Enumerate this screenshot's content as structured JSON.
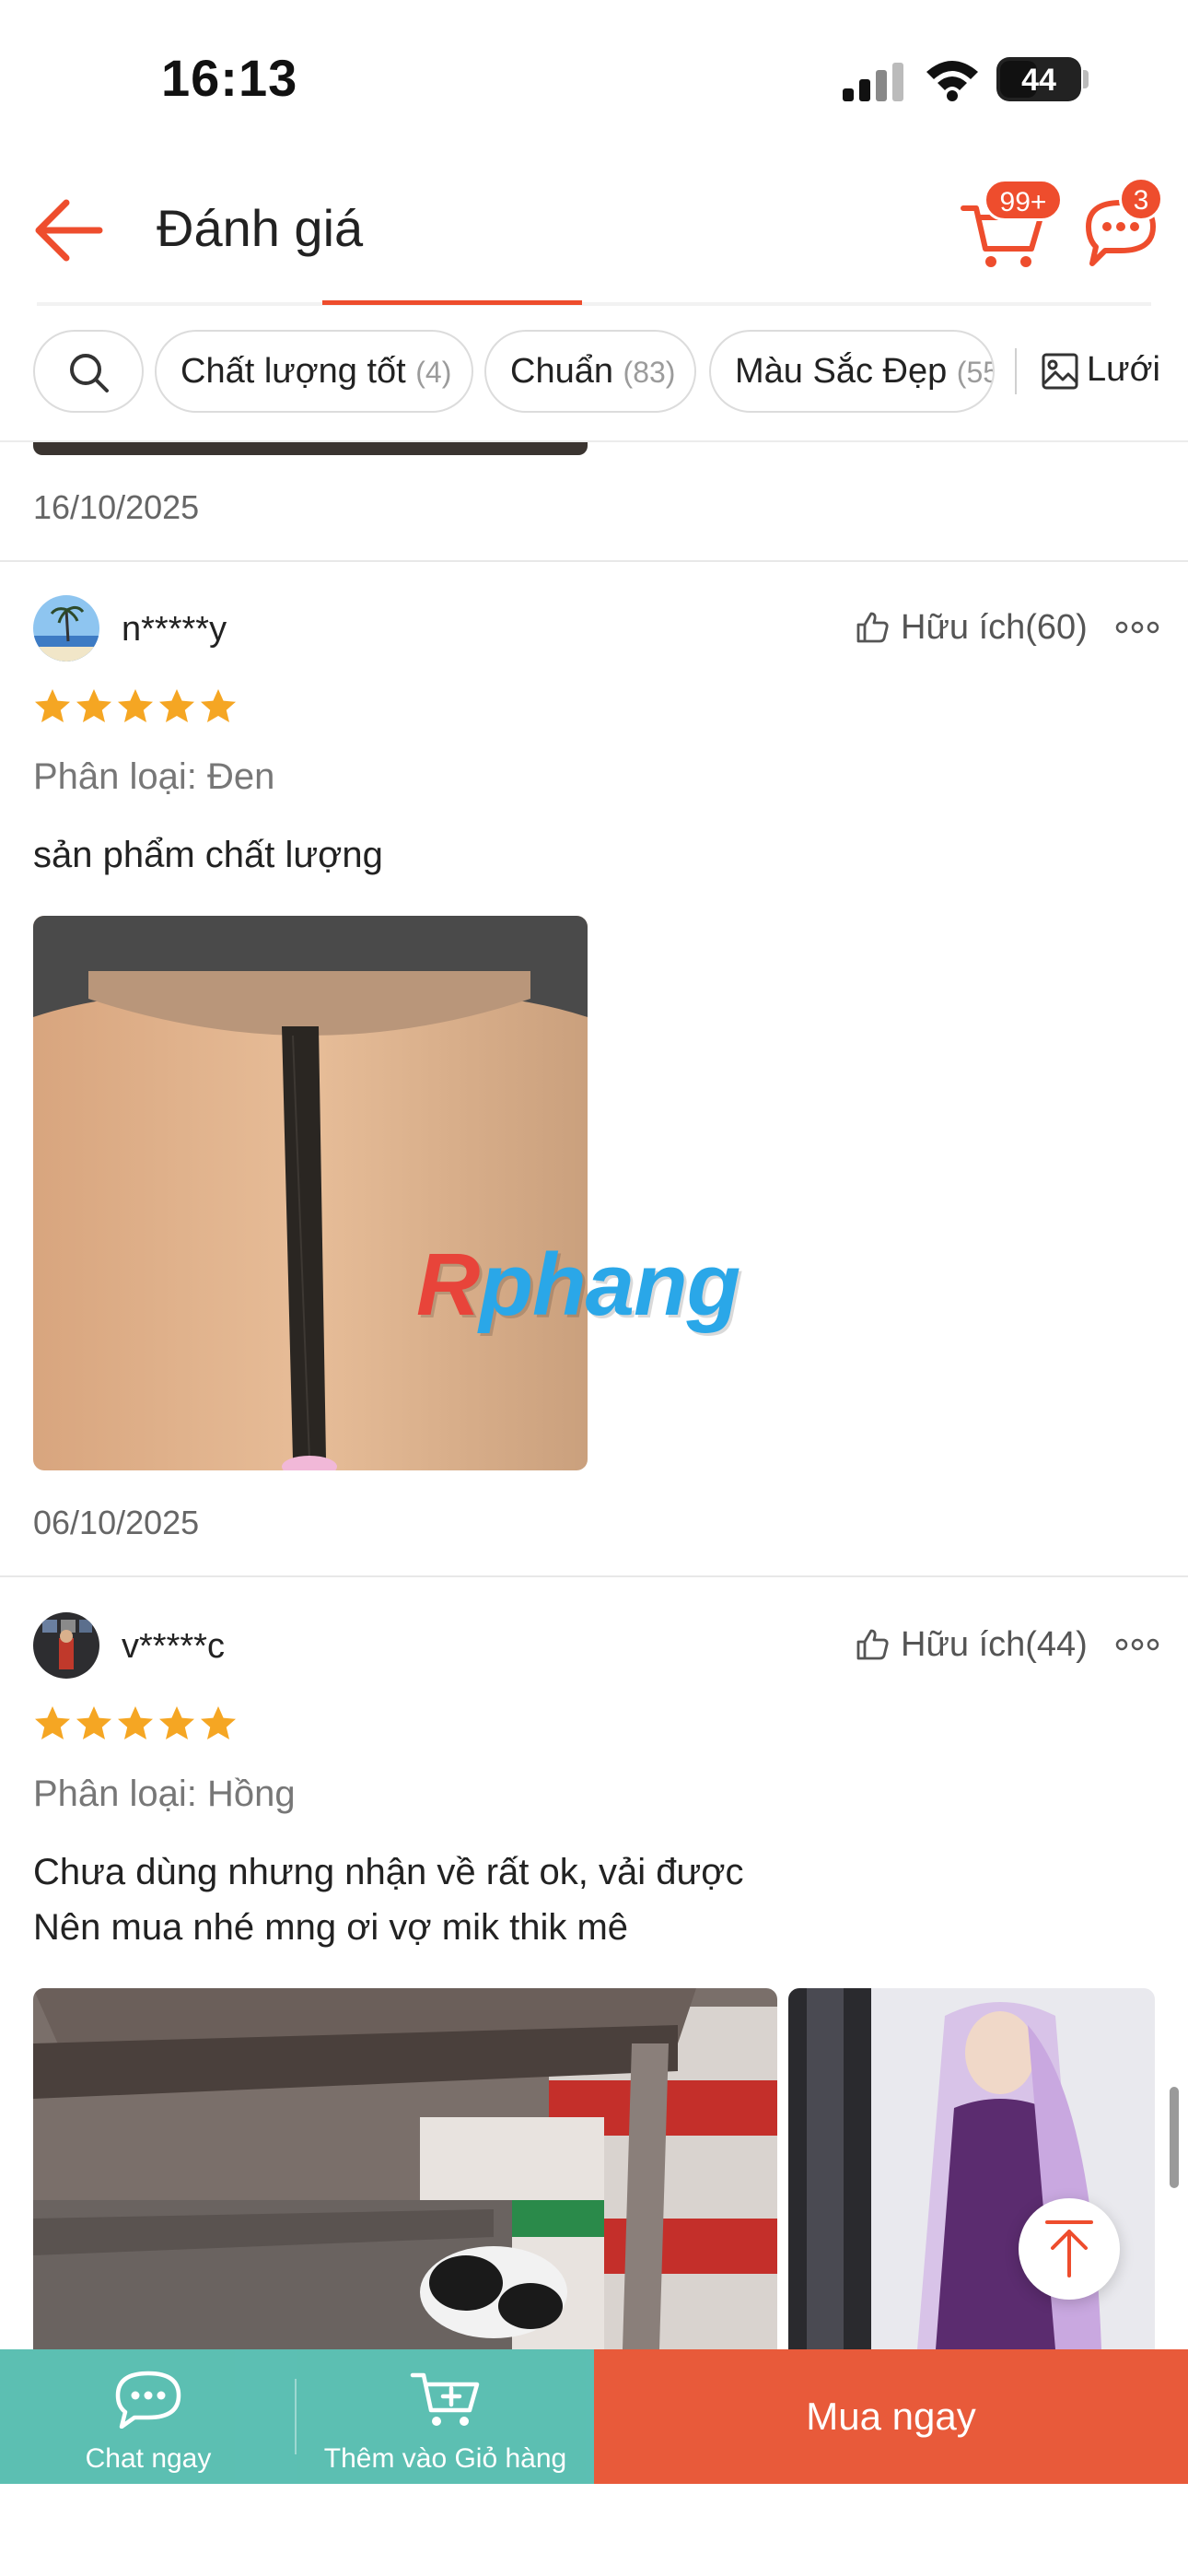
{
  "status_bar": {
    "time": "16:13",
    "battery": "44"
  },
  "header": {
    "title": "Đánh giá",
    "cart_badge": "99+",
    "chat_badge": "3"
  },
  "filters": {
    "chips": [
      {
        "label": "Chất lượng tốt",
        "count": "(4)"
      },
      {
        "label": "Chuẩn",
        "count": "(83)"
      },
      {
        "label": "Màu Sắc Đẹp",
        "count": "(55"
      }
    ],
    "grid_label": "Lưới"
  },
  "previous_review": {
    "date": "16/10/2025"
  },
  "reviews": [
    {
      "username": "n*****y",
      "helpful": "Hữu ích(60)",
      "rating": 5,
      "variant": "Phân loại: Đen",
      "comment_lines": [
        "sản phẩm chất lượng"
      ],
      "date": "06/10/2025"
    },
    {
      "username": "v*****c",
      "helpful": "Hữu ích(44)",
      "rating": 5,
      "variant": "Phân loại: Hồng",
      "comment_lines": [
        "Chưa dùng nhưng nhận về rất ok, vải được",
        "Nên mua nhé mng ơi vợ mik thik mê"
      ]
    }
  ],
  "watermark": {
    "first": "R",
    "rest": "phang"
  },
  "bottom_bar": {
    "chat_label": "Chat ngay",
    "cart_label": "Thêm vào Giỏ hàng",
    "buy_label": "Mua ngay"
  },
  "colors": {
    "accent": "#ee4d2d",
    "star": "#f5a623",
    "bottom_teal": "#26aa99",
    "buy_orange": "#e85a3a"
  }
}
